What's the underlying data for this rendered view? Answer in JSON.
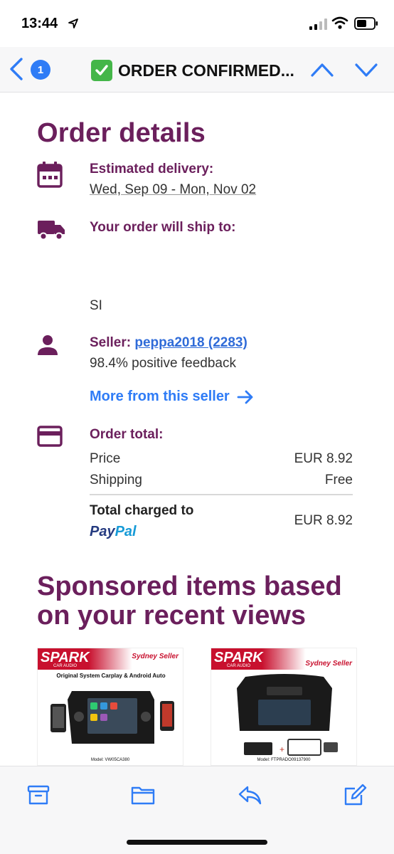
{
  "status_bar": {
    "time": "13:44"
  },
  "nav": {
    "unread_count": "1",
    "subject": "ORDER CONFIRMED..."
  },
  "order": {
    "heading": "Order details",
    "delivery_label": "Estimated delivery:",
    "delivery_value": "Wed, Sep 09 - Mon, Nov 02",
    "ship_label": "Your order will ship to:",
    "ship_value": "SI",
    "seller_label": "Seller:",
    "seller_link": "peppa2018 (2283)",
    "feedback": "98.4% positive feedback",
    "more_link": "More from this seller",
    "total_label": "Order total:",
    "price_label": "Price",
    "price_value": "EUR 8.92",
    "shipping_label": "Shipping",
    "shipping_value": "Free",
    "total_charged_label": "Total charged to",
    "total_charged_value": "EUR 8.92",
    "payment_part1": "Pay",
    "payment_part2": "Pal"
  },
  "sponsored": {
    "heading": "Sponsored items based on your recent views",
    "items": [
      {
        "brand": "SPARK",
        "sub": "CAR AUDIO",
        "seller": "Sydney Seller",
        "caption": "Original System Carplay & Android Auto",
        "model": "Model: VW05CA380"
      },
      {
        "brand": "SPARK",
        "sub": "CAR AUDIO",
        "seller": "Sydney Seller",
        "caption": "",
        "model": "Model: FTPRADO09137900"
      }
    ]
  },
  "colors": {
    "brand_purple": "#6b1f5c",
    "link_blue": "#2f7cf6",
    "ios_blue": "#2f7cf6"
  },
  "toolbar": {
    "icons": [
      "archive-icon",
      "folder-icon",
      "reply-icon",
      "compose-icon"
    ]
  }
}
